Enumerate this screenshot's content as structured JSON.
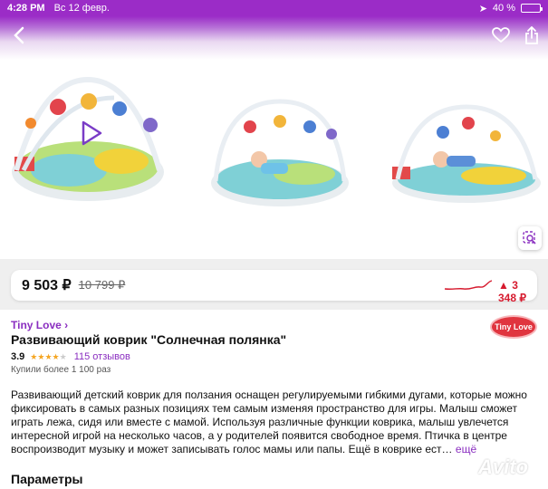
{
  "status_bar": {
    "time": "4:28 PM",
    "date": "Вс 12 февр.",
    "battery": "40 %",
    "battery_level": 0.4
  },
  "header": {
    "back_icon": "chevron-left-icon",
    "favorite_icon": "heart-icon",
    "share_icon": "share-icon"
  },
  "gallery": {
    "photo_count": 3,
    "has_video": true,
    "lens_icon": "image-search-icon"
  },
  "price": {
    "current": "9 503 ₽",
    "old": "10 799 ₽",
    "difference": "▲ 3 348 ₽",
    "difference_color": "#d61a2e"
  },
  "product": {
    "brand": "Tiny Love ›",
    "brand_logo": "Tiny Love",
    "title": "Развивающий коврик \"Солнечная полянка\"",
    "rating": "3.9",
    "stars": 3.9,
    "reviews": "115 отзывов",
    "purchases": "Купили более 1 100 раз"
  },
  "description": {
    "text": "Развивающий детский коврик для ползания оснащен регулируемыми гибкими дугами, которые можно фиксировать в самых разных позициях тем самым изменяя пространство для игры. Малыш сможет играть лежа, сидя или вместе с мамой. Используя различные функции коврика, малыш увлечется интересной игрой на несколько часов, а у родителей появится свободное время. Птичка в центре воспроизводит музыку и может записывать голос мамы или папы. Ещё в коврике ест…",
    "more": "ещё"
  },
  "sections": {
    "params_title": "Параметры"
  },
  "watermark": "Avito",
  "colors": {
    "accent": "#8a2ec0",
    "status_bar": "#9b2cc7",
    "price_up": "#d61a2e"
  }
}
